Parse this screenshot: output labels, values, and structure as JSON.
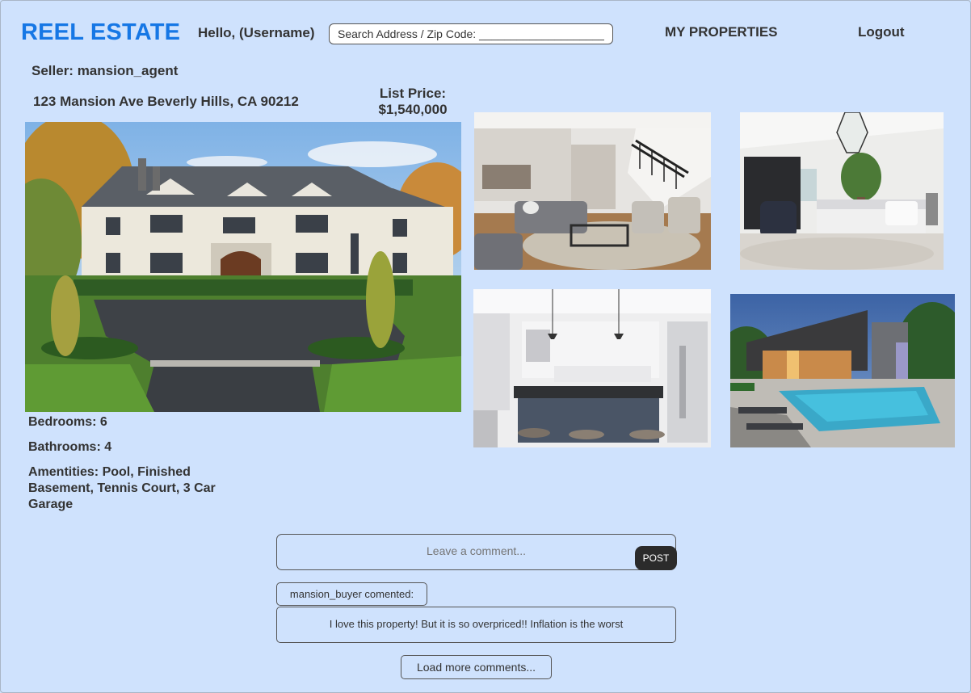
{
  "header": {
    "logo": "REEL ESTATE",
    "greeting": "Hello, (Username)",
    "search_value": "Search Address / Zip Code: ______________________",
    "nav_my_properties": "MY PROPERTIES",
    "nav_logout": "Logout"
  },
  "listing": {
    "seller": "Seller: mansion_agent",
    "address": "123 Mansion Ave Beverly Hills, CA 90212",
    "price_label": "List Price:",
    "price_value": "$1,540,000",
    "bedrooms": "Bedrooms: 6",
    "bathrooms": "Bathrooms: 4",
    "amenities": "Amentities: Pool, Finished Basement, Tennis Court, 3 Car Garage"
  },
  "comments": {
    "placeholder": "Leave a comment...",
    "post_label": "POST",
    "items": [
      {
        "author": "mansion_buyer comented:",
        "text": "I love this property! But it is so overpriced!! Inflation is the worst"
      }
    ],
    "load_more_label": "Load more comments..."
  },
  "colors": {
    "background": "#cfe2fd",
    "brand": "#1677e5",
    "post_button": "#2b2b2b"
  }
}
